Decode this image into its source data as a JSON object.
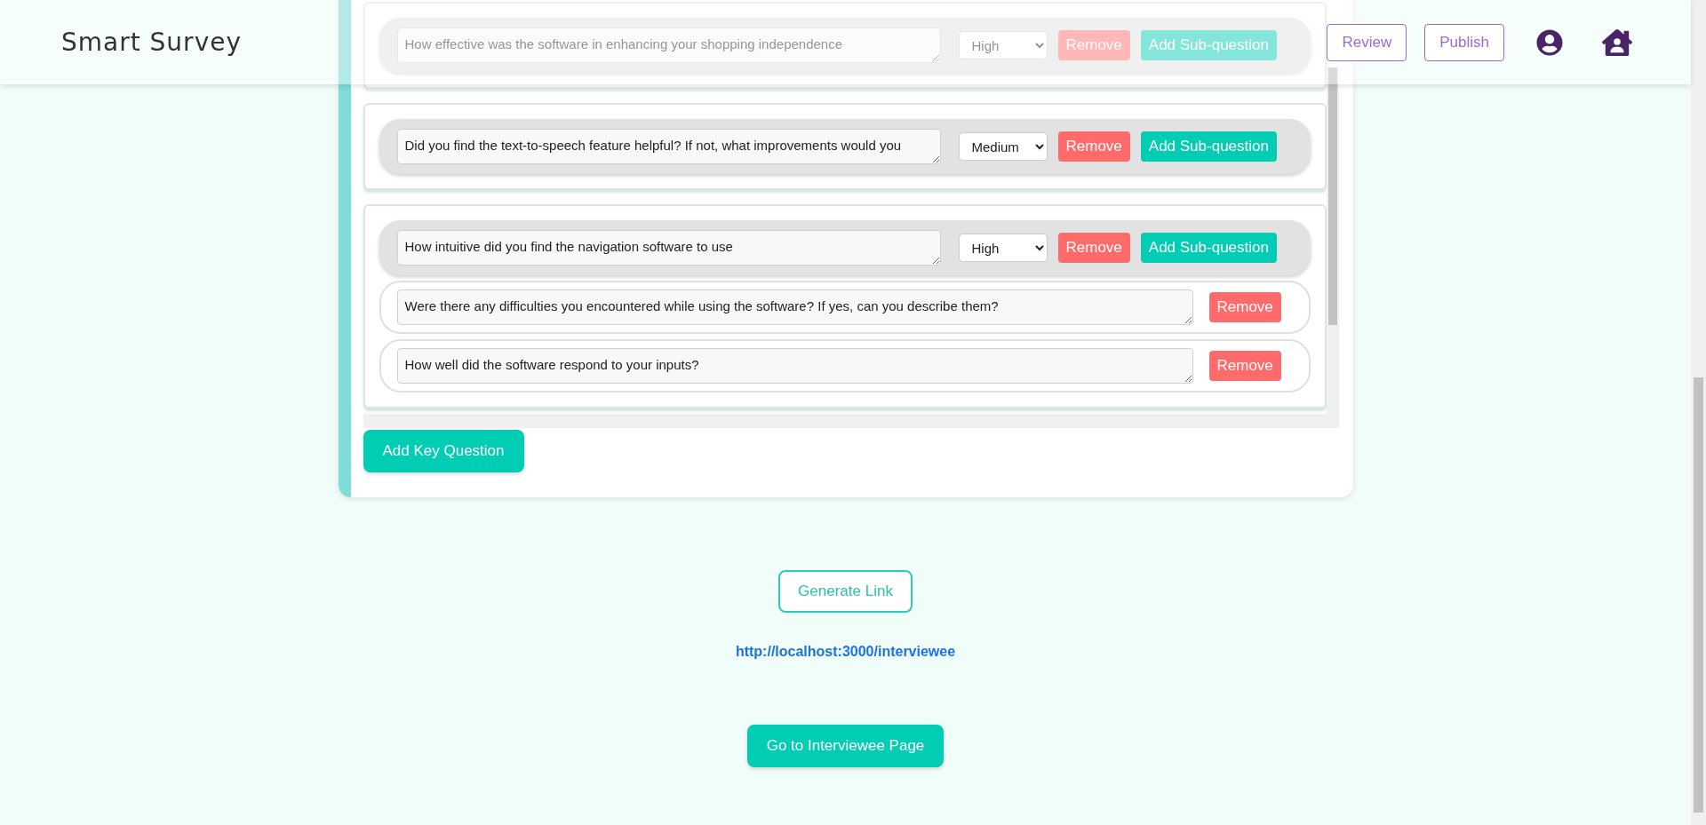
{
  "header": {
    "title": "Smart Survey",
    "buttons": [
      "Review",
      "Publish"
    ]
  },
  "key_questions": [
    {
      "question": "How effective was the software in enhancing your shopping independence",
      "priority": "High",
      "faded": true,
      "remove": "Remove",
      "add_sub": "Add Sub-question"
    },
    {
      "question": "Did you find the text-to-speech feature helpful? If not, what improvements would you",
      "priority": "Medium",
      "faded": false,
      "remove": "Remove",
      "add_sub": "Add Sub-question"
    },
    {
      "question": "How intuitive did you find the navigation software to use",
      "priority": "High",
      "faded": false,
      "remove": "Remove",
      "add_sub": "Add Sub-question",
      "sub_questions": [
        {
          "question": "Were there any difficulties you encountered while using the software? If yes, can you describe them?",
          "remove": "Remove"
        },
        {
          "question": "How well did the software respond to your inputs?",
          "remove": "Remove"
        }
      ]
    }
  ],
  "add_key_question": "Add Key Question",
  "generate_link": "Generate Link",
  "link": "http://localhost:3000/interviewee",
  "go_button": "Go to Interviewee Page"
}
